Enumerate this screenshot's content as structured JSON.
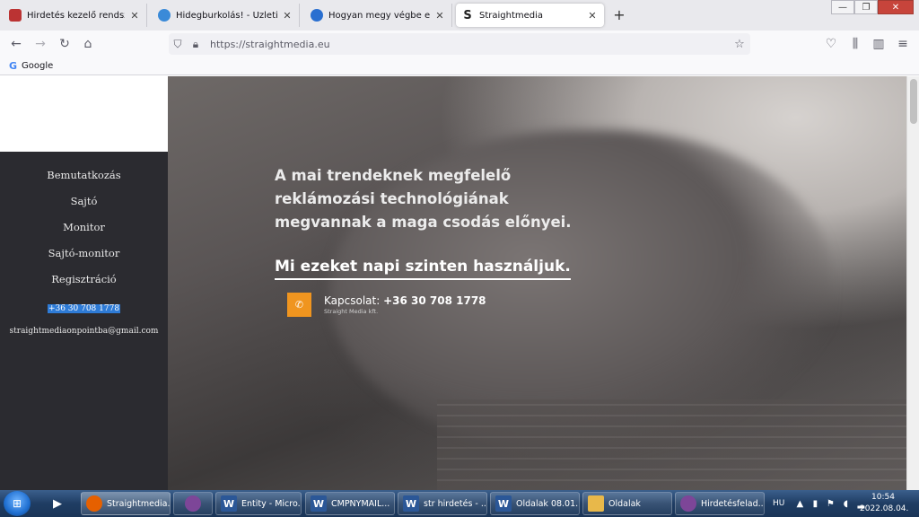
{
  "browser": {
    "tabs": [
      {
        "label": "Hirdetés kezelő rendszer webol",
        "icon": "photo-favicon",
        "icon_color": "#b33"
      },
      {
        "label": "Hidegburkolás! - Üzleti hirdető",
        "icon": "globe-favicon",
        "icon_color": "#3a8ad8"
      },
      {
        "label": "Hogyan megy végbe egy webol",
        "icon": "site-favicon",
        "icon_color": "#2a6fd0"
      },
      {
        "label": "Straightmedia",
        "icon": "s-favicon",
        "icon_glyph": "S",
        "icon_color": "#222"
      }
    ],
    "tab_close_glyph": "✕",
    "new_tab_glyph": "+",
    "url": "https://straightmedia.eu",
    "bookmarks": [
      {
        "label": "Google",
        "icon": "google-icon",
        "glyph": "G"
      }
    ]
  },
  "page": {
    "nav": [
      {
        "label": "Bemutatkozás"
      },
      {
        "label": "Sajtó"
      },
      {
        "label": "Monitor"
      },
      {
        "label": "Sajtó-monitor"
      },
      {
        "label": "Regisztráció"
      }
    ],
    "phone_highlighted": "+36 30 708 1778",
    "email": "straightmediaonpointba@gmail.com",
    "hero": {
      "headline": "A mai trendeknek megfelelő reklámozási technológiának megvannak a maga csodás előnyei.",
      "subline": "Mi ezeket napi szinten használjuk.",
      "contact_label": "Kapcsolat: ",
      "contact_phone": "+36 30 708 1778",
      "contact_company": "Straight Media kft.",
      "accent_color": "#f0951f"
    }
  },
  "taskbar": {
    "items": [
      {
        "label": "Straightmedia...",
        "icon": "firefox-icon",
        "icon_color": "#e66000",
        "active": true
      },
      {
        "label": "",
        "icon": "tor-icon",
        "icon_color": "#7d4698"
      },
      {
        "label": "Entity - Micro...",
        "icon": "word-icon",
        "icon_color": "#2b5797"
      },
      {
        "label": "CMPNYMAIL...",
        "icon": "word-icon",
        "icon_color": "#2b5797"
      },
      {
        "label": "str hirdetés - ...",
        "icon": "word-icon",
        "icon_color": "#2b5797"
      },
      {
        "label": "Oldalak 08.01....",
        "icon": "word-icon",
        "icon_color": "#2b5797"
      },
      {
        "label": "Oldalak",
        "icon": "folder-icon",
        "icon_color": "#e8b84a"
      },
      {
        "label": "Hirdetésfelad...",
        "icon": "tor-icon",
        "icon_color": "#7d4698"
      }
    ],
    "language": "HU",
    "time": "10:54",
    "date": "2022.08.04."
  }
}
